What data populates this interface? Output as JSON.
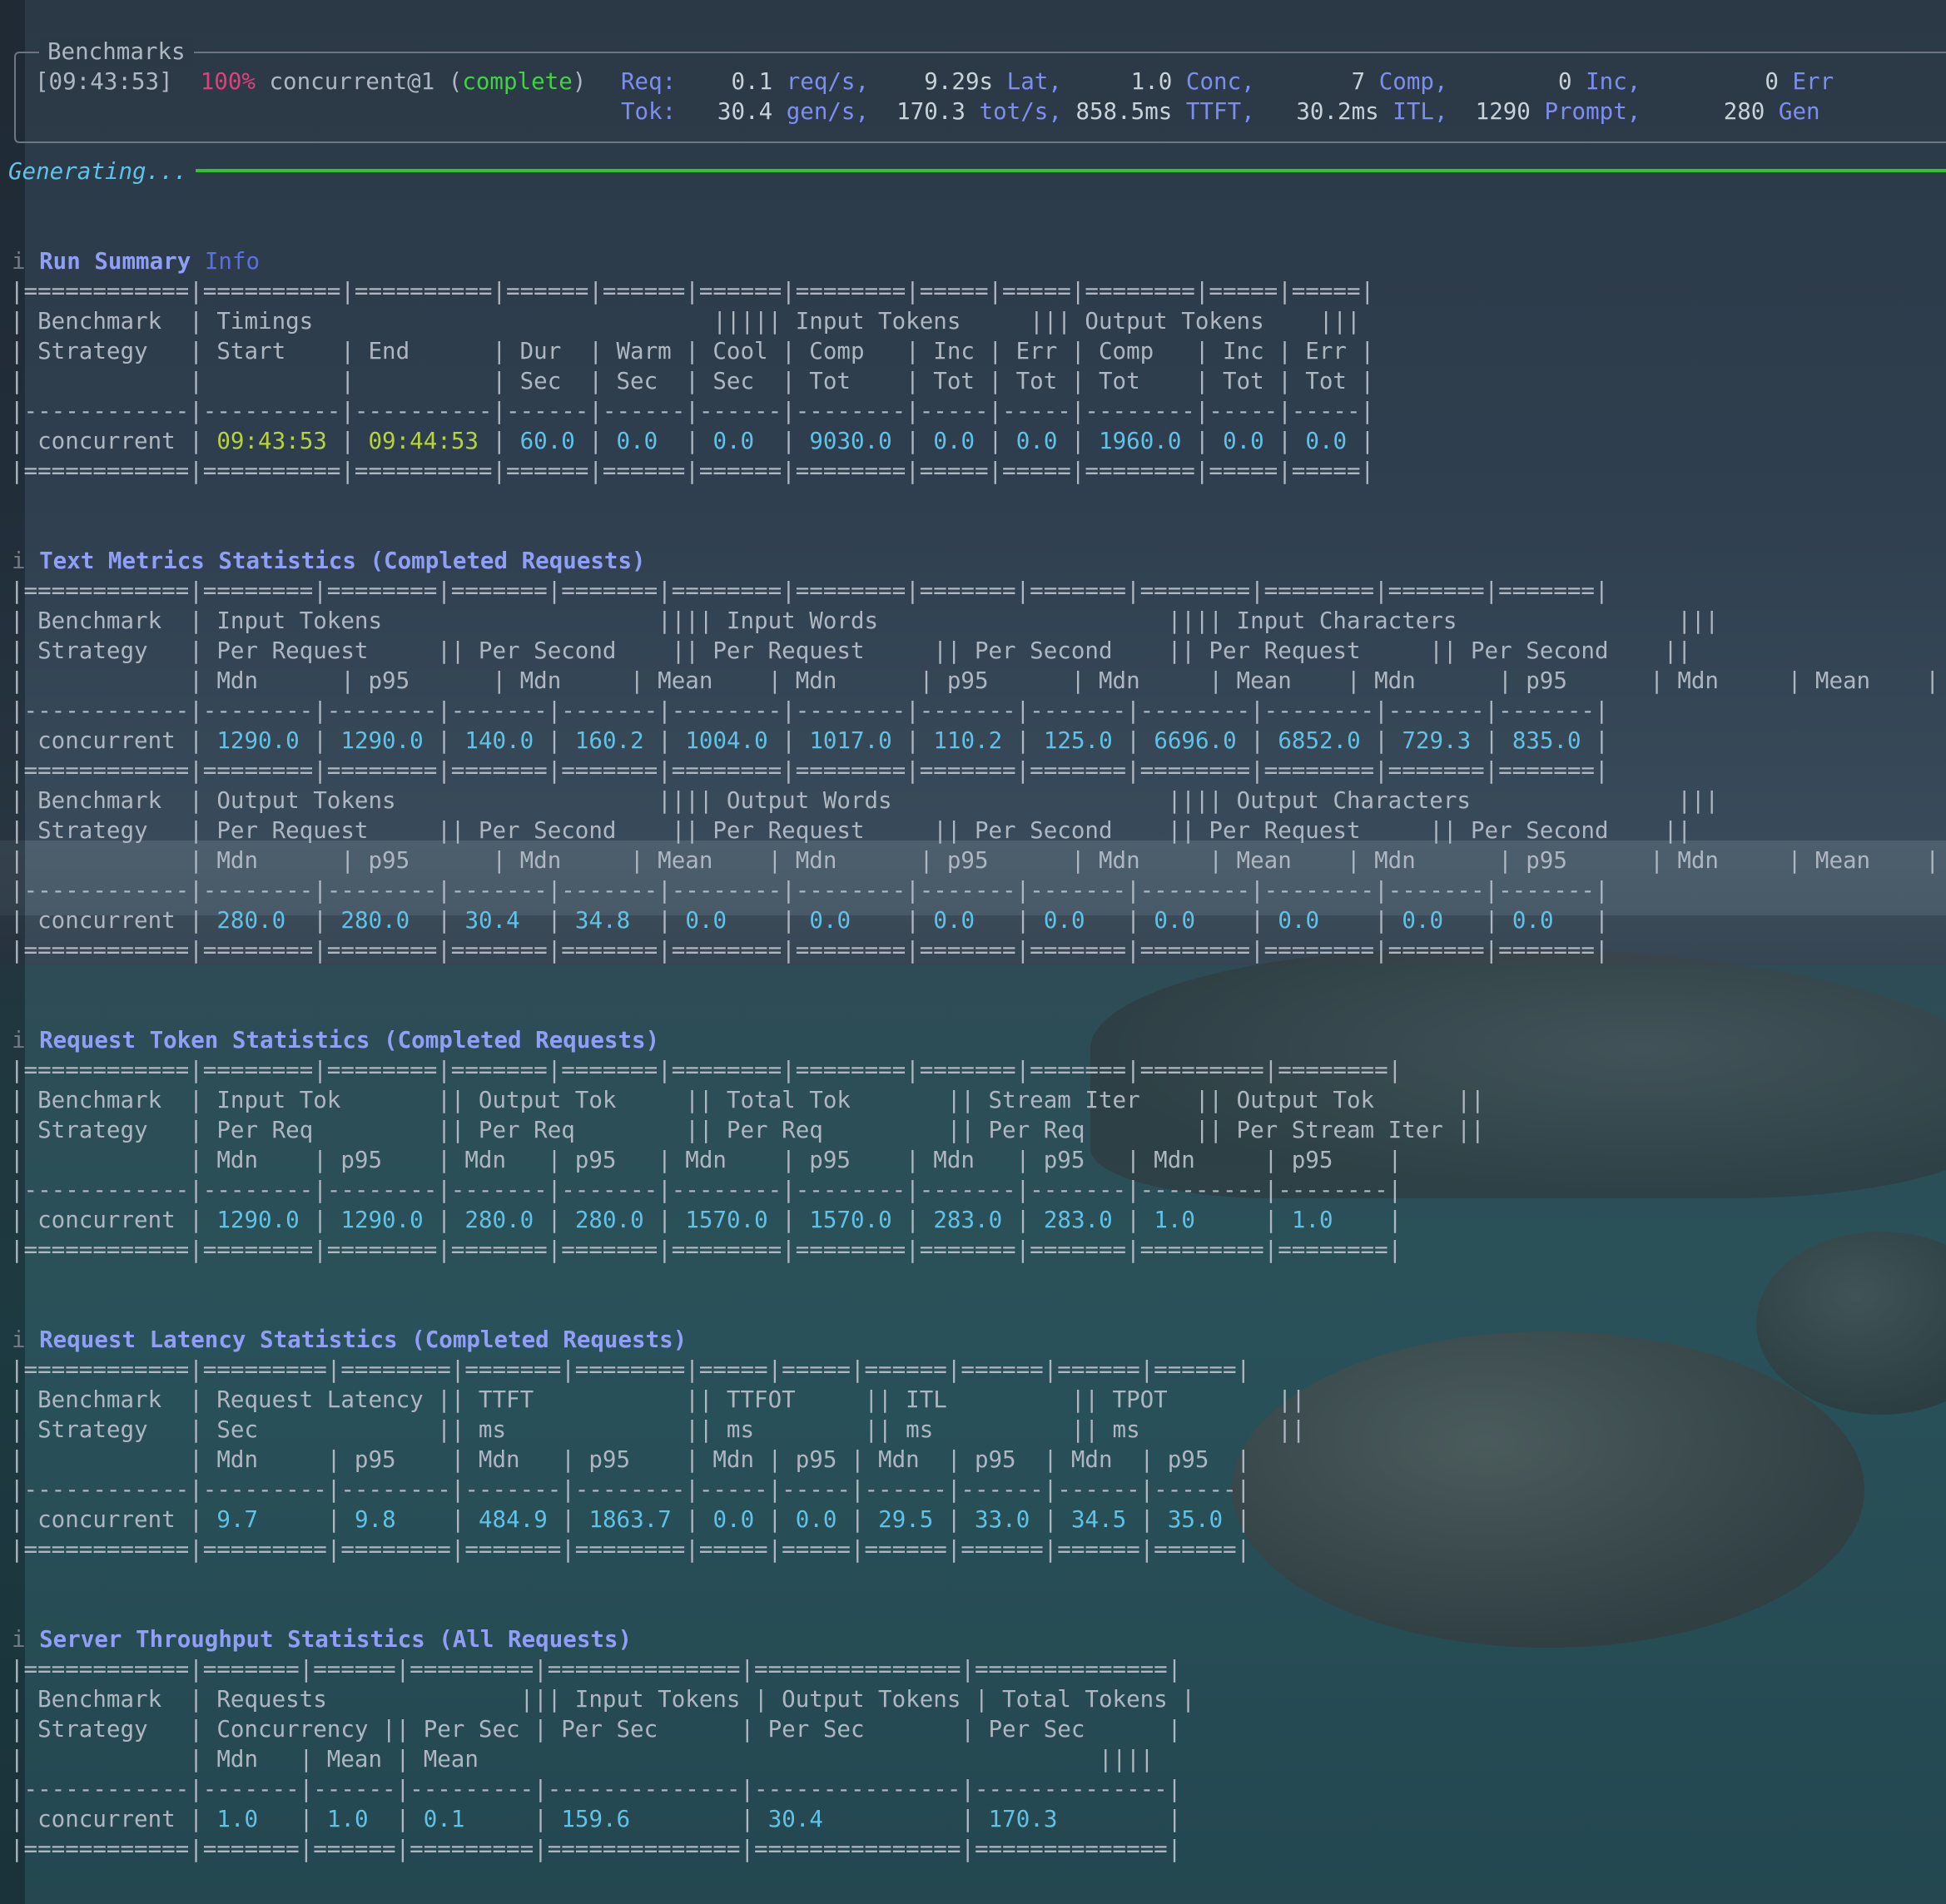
{
  "colors": {
    "red": "#e0407a",
    "green": "#3fd33f",
    "label": "#7c8ef0",
    "cyan": "#5fc2e6",
    "timestamp": "#b5d33a",
    "progress": "#2fc52f"
  },
  "header": {
    "title": "Benchmarks",
    "time": "[09:43:53]",
    "percent": "100%",
    "run_name": "concurrent@1",
    "status": "complete",
    "req": {
      "label": "Req:",
      "rate": "0.1",
      "rate_unit": "req/s,",
      "lat": "9.29s",
      "lat_unit": "Lat,",
      "conc": "1.0",
      "conc_unit": "Conc,",
      "comp": "7",
      "comp_unit": "Comp,",
      "inc": "0",
      "inc_unit": "Inc,",
      "err": "0",
      "err_unit": "Err"
    },
    "tok": {
      "label": "Tok:",
      "gen": "30.4",
      "gen_unit": "gen/s,",
      "tot": "170.3",
      "tot_unit": "tot/s,",
      "ttft": "858.5ms",
      "ttft_unit": "TTFT,",
      "itl": "30.2ms",
      "itl_unit": "ITL,",
      "prompt": "1290",
      "prompt_unit": "Prompt,",
      "gen_count": "280",
      "gen_count_unit": "Gen"
    }
  },
  "progress": {
    "label": "Generating...",
    "fraction": 1.0
  },
  "sections": {
    "run_summary": {
      "title": "Run Summary",
      "badge": "Info"
    },
    "text_metrics": {
      "title": "Text Metrics Statistics (Completed Requests)"
    },
    "request_token": {
      "title": "Request Token Statistics (Completed Requests)"
    },
    "request_latency": {
      "title": "Request Latency Statistics (Completed Requests)"
    },
    "server_throughput": {
      "title": "Server Throughput Statistics (All Requests)"
    }
  },
  "tables": {
    "run_summary": {
      "lines": [
        "|============|==========|==========|======|======|======|========|=====|=====|========|=====|=====|",
        "| Benchmark  | Timings                             ||||| Input Tokens     ||| Output Tokens    |||",
        "| Strategy   | Start    | End      | Dur  | Warm | Cool | Comp   | Inc | Err | Comp   | Inc | Err |",
        "|            |          |          | Sec  | Sec  | Sec  | Tot    | Tot | Tot | Tot    | Tot | Tot |",
        "|------------|----------|----------|------|------|------|--------|-----|-----|--------|-----|-----|"
      ],
      "row": {
        "strategy": "concurrent",
        "start": "09:43:53",
        "end": "09:44:53",
        "dur": "60.0",
        "warm": "0.0",
        "cool": "0.0",
        "in_comp": "9030.0",
        "in_inc": "0.0",
        "in_err": "0.0",
        "out_comp": "1960.0",
        "out_inc": "0.0",
        "out_err": "0.0"
      },
      "bottom": "|============|==========|==========|======|======|======|========|=====|=====|========|=====|=====|"
    },
    "text_metrics": {
      "top": "|============|========|========|=======|=======|========|========|=======|=======|========|========|=======|=======|",
      "input_lines": [
        "| Benchmark  | Input Tokens                    |||| Input Words                     |||| Input Characters                |||",
        "| Strategy   | Per Request     || Per Second    || Per Request     || Per Second    || Per Request     || Per Second    ||",
        "|            | Mdn      | p95      | Mdn     | Mean    | Mdn      | p95      | Mdn     | Mean    | Mdn      | p95      | Mdn     | Mean    |",
        "|------------|--------|--------|-------|-------|--------|--------|-------|-------|--------|--------|-------|-------|"
      ],
      "input_row": {
        "strategy": "concurrent",
        "v": [
          "1290.0",
          "1290.0",
          "140.0",
          "160.2",
          "1004.0",
          "1017.0",
          "110.2",
          "125.0",
          "6696.0",
          "6852.0",
          "729.3",
          "835.0"
        ]
      },
      "mid": "|============|========|========|=======|=======|========|========|=======|=======|========|========|=======|=======|",
      "output_lines": [
        "| Benchmark  | Output Tokens                   |||| Output Words                    |||| Output Characters               |||",
        "| Strategy   | Per Request     || Per Second    || Per Request     || Per Second    || Per Request     || Per Second    ||",
        "|            | Mdn      | p95      | Mdn     | Mean    | Mdn      | p95      | Mdn     | Mean    | Mdn      | p95      | Mdn     | Mean    |",
        "|------------|--------|--------|-------|-------|--------|--------|-------|-------|--------|--------|-------|-------|"
      ],
      "output_row": {
        "strategy": "concurrent",
        "v": [
          "280.0",
          "280.0",
          "30.4",
          "34.8",
          "0.0",
          "0.0",
          "0.0",
          "0.0",
          "0.0",
          "0.0",
          "0.0",
          "0.0"
        ]
      },
      "bottom": "|============|========|========|=======|=======|========|========|=======|=======|========|========|=======|=======|"
    },
    "request_token": {
      "lines": [
        "|============|========|========|=======|=======|========|========|=======|=======|=========|========|",
        "| Benchmark  | Input Tok       || Output Tok     || Total Tok       || Stream Iter    || Output Tok      ||",
        "| Strategy   | Per Req         || Per Req        || Per Req         || Per Req        || Per Stream Iter ||",
        "|            | Mdn    | p95    | Mdn   | p95   | Mdn    | p95    | Mdn   | p95   | Mdn     | p95    |",
        "|------------|--------|--------|-------|-------|--------|--------|-------|-------|---------|--------|"
      ],
      "row": {
        "strategy": "concurrent",
        "v": [
          "1290.0",
          "1290.0",
          "280.0",
          "280.0",
          "1570.0",
          "1570.0",
          "283.0",
          "283.0",
          "1.0",
          "1.0"
        ]
      },
      "bottom": "|============|========|========|=======|=======|========|========|=======|=======|=========|========|"
    },
    "request_latency": {
      "lines": [
        "|============|=========|========|=======|========|=====|=====|======|======|======|======|",
        "| Benchmark  | Request Latency || TTFT           || TTFOT     || ITL         || TPOT        ||",
        "| Strategy   | Sec             || ms             || ms        || ms          || ms          ||",
        "|            | Mdn     | p95    | Mdn   | p95    | Mdn | p95 | Mdn  | p95  | Mdn  | p95  |",
        "|------------|---------|--------|-------|--------|-----|-----|------|------|------|------|"
      ],
      "row": {
        "strategy": "concurrent",
        "v": [
          "9.7",
          "9.8",
          "484.9",
          "1863.7",
          "0.0",
          "0.0",
          "29.5",
          "33.0",
          "34.5",
          "35.0"
        ]
      },
      "bottom": "|============|=========|========|=======|========|=====|=====|======|======|======|======|"
    },
    "server_throughput": {
      "lines": [
        "|============|=======|======|=========|==============|===============|==============|",
        "| Benchmark  | Requests              ||| Input Tokens | Output Tokens | Total Tokens |",
        "| Strategy   | Concurrency || Per Sec | Per Sec      | Per Sec       | Per Sec      |",
        "|            | Mdn   | Mean | Mean                                             ||||",
        "|------------|-------|------|---------|--------------|---------------|--------------|"
      ],
      "row": {
        "strategy": "concurrent",
        "v": [
          "1.0",
          "1.0",
          "0.1",
          "159.6",
          "30.4",
          "170.3"
        ]
      },
      "bottom": "|============|=======|======|=========|==============|===============|==============|"
    }
  }
}
